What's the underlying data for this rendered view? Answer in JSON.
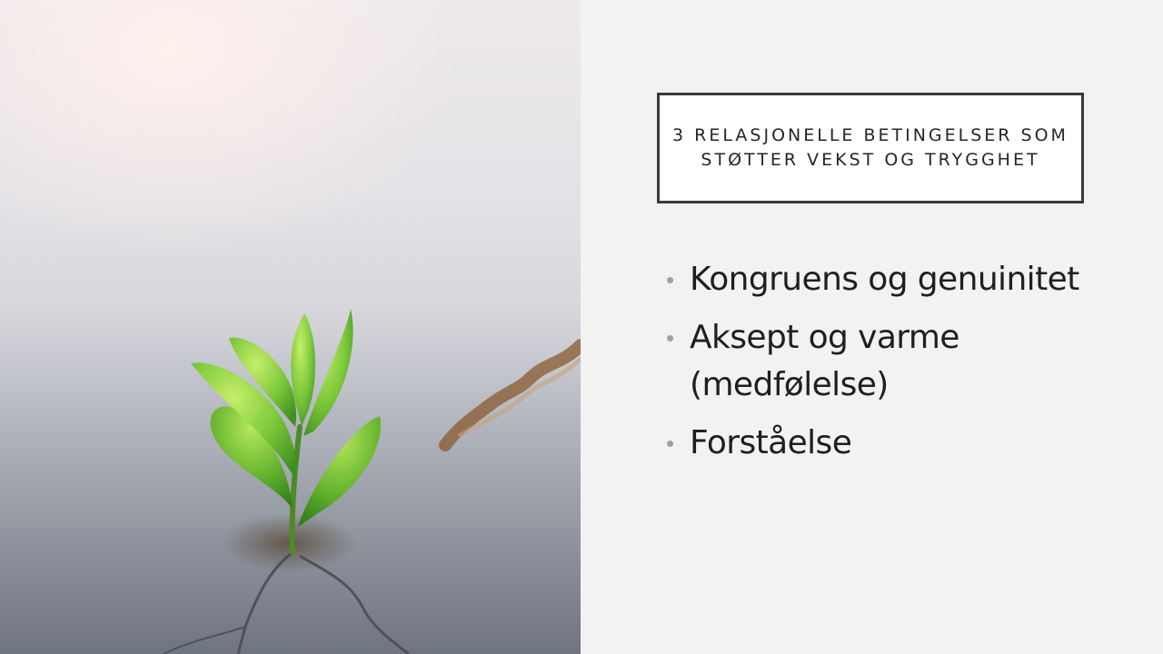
{
  "slide": {
    "title": "3 Relasjonelle betingelser som støtter vekst og trygghet",
    "bullets": [
      {
        "text": "Kongruens og genuinitet"
      },
      {
        "text": "Aksept og varme (medfølelse)"
      },
      {
        "text": "Forståelse"
      }
    ]
  },
  "image": {
    "subject": "sprout-icon"
  },
  "colors": {
    "background": "#f2f2f2",
    "title_border": "#3a3a3a",
    "bullet_marker": "#95a5a6",
    "text": "#1f1f1f",
    "leaf": "#7cc83a"
  }
}
